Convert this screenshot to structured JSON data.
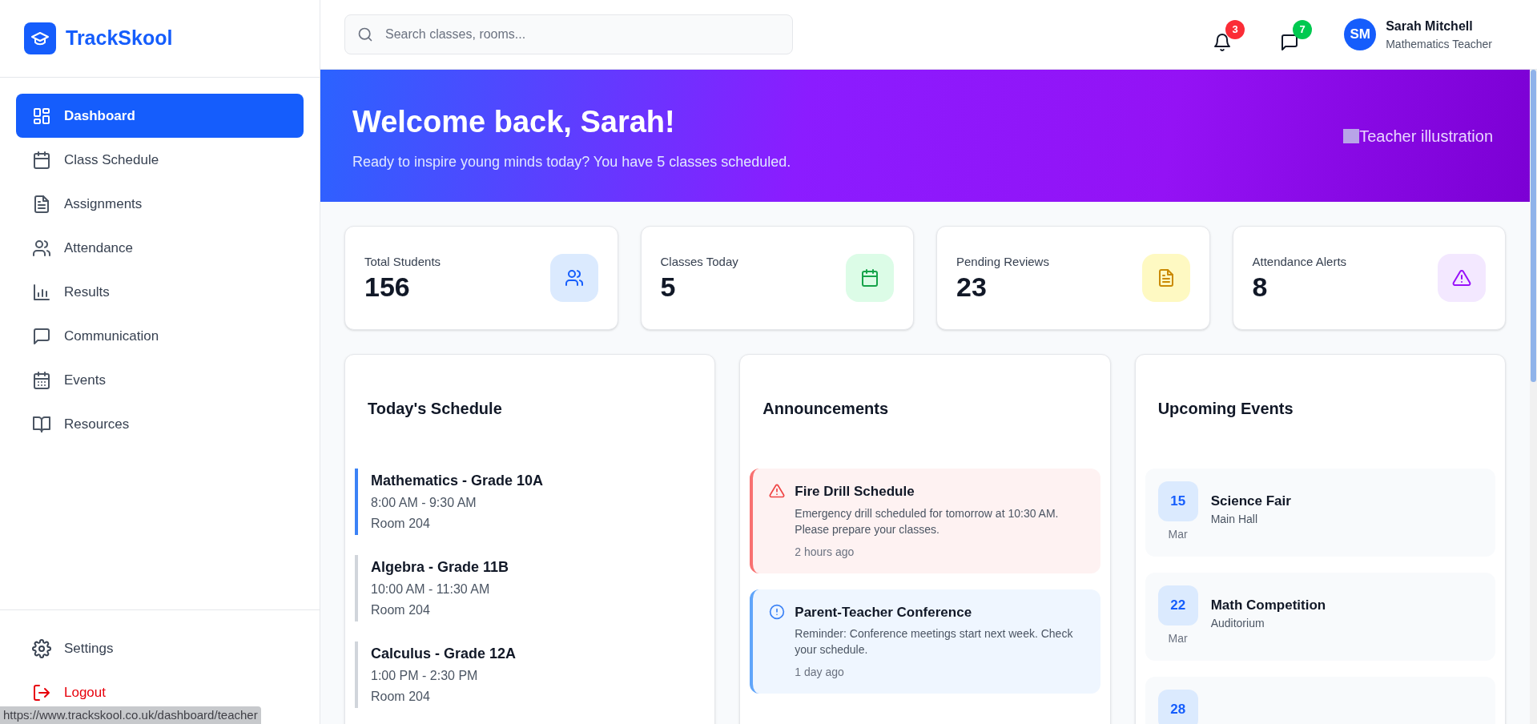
{
  "sidebar": {
    "brand": "TrackSkool",
    "nav": [
      {
        "label": "Dashboard",
        "selected": true
      },
      {
        "label": "Class Schedule",
        "selected": false
      },
      {
        "label": "Assignments",
        "selected": false
      },
      {
        "label": "Attendance",
        "selected": false
      },
      {
        "label": "Results",
        "selected": false
      },
      {
        "label": "Communication",
        "selected": false
      },
      {
        "label": "Events",
        "selected": false
      },
      {
        "label": "Resources",
        "selected": false
      }
    ],
    "footer": [
      {
        "label": "Settings",
        "kind": "normal"
      },
      {
        "label": "Logout",
        "kind": "danger"
      }
    ]
  },
  "header": {
    "search": {
      "placeholder": "Search classes, rooms..."
    },
    "notifications": "3",
    "messages": "7",
    "user": {
      "initials": "SM",
      "name": "Sarah Mitchell",
      "role": "Mathematics Teacher"
    }
  },
  "banner": {
    "title": "Welcome back, Sarah!",
    "subtitle": "Ready to inspire young minds today? You have 5 classes scheduled.",
    "image_alt": "Teacher illustration"
  },
  "stats": [
    {
      "label": "Total Students",
      "value": "156",
      "kind": "students"
    },
    {
      "label": "Classes Today",
      "value": "5",
      "kind": "classes"
    },
    {
      "label": "Pending Reviews",
      "value": "23",
      "kind": "reviews"
    },
    {
      "label": "Attendance Alerts",
      "value": "8",
      "kind": "alerts"
    }
  ],
  "schedule": {
    "title": "Today's Schedule",
    "items": [
      {
        "subject": "Mathematics - Grade 10A",
        "time": "8:00 AM - 9:30 AM",
        "room": "Room 204",
        "current": true
      },
      {
        "subject": "Algebra - Grade 11B",
        "time": "10:00 AM - 11:30 AM",
        "room": "Room 204",
        "current": false
      },
      {
        "subject": "Calculus - Grade 12A",
        "time": "1:00 PM - 2:30 PM",
        "room": "Room 204",
        "current": false
      }
    ]
  },
  "announcements": {
    "title": "Announcements",
    "items": [
      {
        "kind": "alert",
        "title": "Fire Drill Schedule",
        "body": "Emergency drill scheduled for tomorrow at 10:30 AM. Please prepare your classes.",
        "time": "2 hours ago"
      },
      {
        "kind": "info",
        "title": "Parent-Teacher Conference",
        "body": "Reminder: Conference meetings start next week. Check your schedule.",
        "time": "1 day ago"
      }
    ]
  },
  "events": {
    "title": "Upcoming Events",
    "items": [
      {
        "day": "15",
        "month": "Mar",
        "title": "Science Fair",
        "place": "Main Hall"
      },
      {
        "day": "22",
        "month": "Mar",
        "title": "Math Competition",
        "place": "Auditorium"
      },
      {
        "day": "28"
      }
    ]
  },
  "status_url": "https://www.trackskool.co.uk/dashboard/teacher"
}
